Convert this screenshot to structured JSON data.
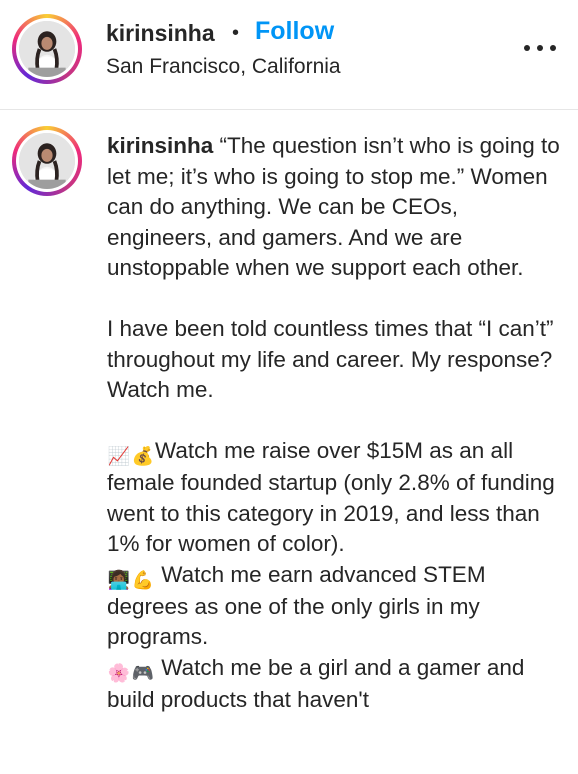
{
  "header": {
    "username": "kirinsinha",
    "separator": "•",
    "follow_label": "Follow",
    "location": "San Francisco, California"
  },
  "caption": {
    "username": "kirinsinha",
    "p1": " “The question isn’t who is going to let me; it’s who is going to stop me.” Women can do anything. We can be CEOs, engineers, and gamers. And we are unstoppable when we support each other.",
    "p2": "I have been told countless times that “I can’t” throughout my life and career. My response? Watch me.",
    "l1_emoji1": "📈",
    "l1_emoji2": "💰",
    "l1_text": "Watch me raise over $15M as an all female founded startup (only 2.8% of funding went to this category in 2019, and less than 1% for women of color).",
    "l2_emoji1": "👩🏾‍💻",
    "l2_emoji2": "💪",
    "l2_text": " Watch me earn advanced STEM degrees as one of the only girls in my programs.",
    "l3_emoji1": "🌸",
    "l3_emoji2": "🎮",
    "l3_text": " Watch me be a girl and a gamer and build products that haven't"
  }
}
